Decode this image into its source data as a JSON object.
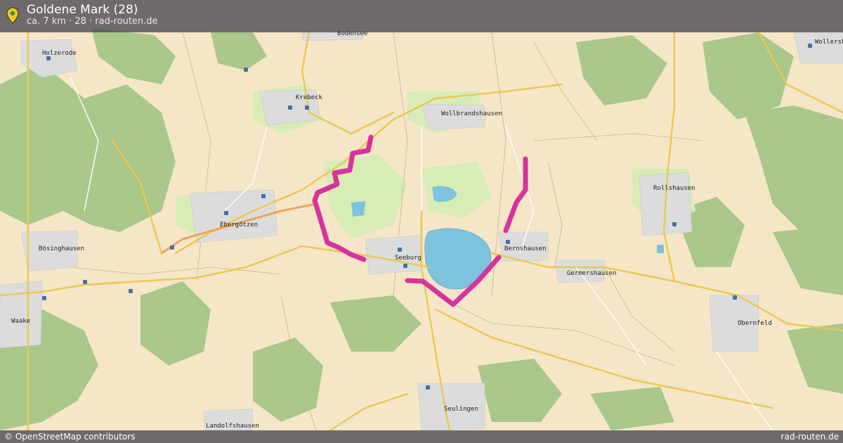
{
  "header": {
    "title": "Goldene Mark (28)",
    "subtitle": "ca. 7 km · 28 · rad-routen.de"
  },
  "footer": {
    "attribution": "© OpenStreetMap contributors",
    "brand": "rad-routen.de"
  },
  "map": {
    "places": [
      {
        "key": "holzerode",
        "name": "Holzerode"
      },
      {
        "key": "krebeck",
        "name": "Krebeck"
      },
      {
        "key": "wollbrandshausen",
        "name": "Wollbrandshausen"
      },
      {
        "key": "ebergoetzen",
        "name": "Ebergötzen"
      },
      {
        "key": "boesinghausen",
        "name": "Bösinghausen"
      },
      {
        "key": "seeburg",
        "name": "Seeburg"
      },
      {
        "key": "bernshausen",
        "name": "Bernshausen"
      },
      {
        "key": "germershausen",
        "name": "Germershausen"
      },
      {
        "key": "rollshausen",
        "name": "Rollshausen"
      },
      {
        "key": "obernfeld",
        "name": "Obernfeld"
      },
      {
        "key": "waake",
        "name": "Waake"
      },
      {
        "key": "seulingen",
        "name": "Seulingen"
      },
      {
        "key": "landolfshausen",
        "name": "Landolfshausen"
      },
      {
        "key": "bodensee",
        "name": "Bodensee"
      },
      {
        "key": "wollershausen",
        "name": "Wollersh"
      }
    ],
    "route_color": "#d6339c",
    "water_color": "#7ec3dd",
    "forest_color": "#a9c88a"
  }
}
